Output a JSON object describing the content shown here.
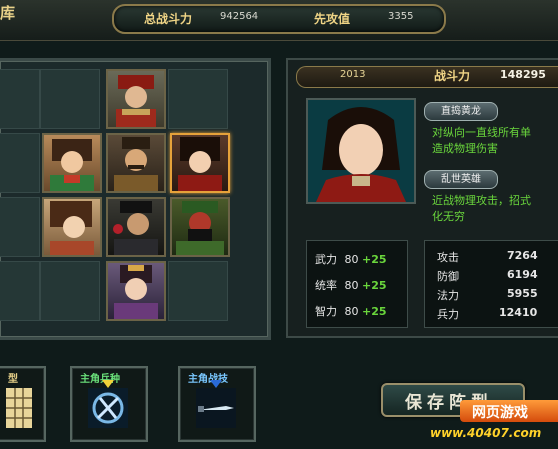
{
  "header": {
    "corner_title": "库",
    "total_power_label": "总战斗力",
    "total_power_value": "942564",
    "initiative_label": "先攻值",
    "initiative_value": "3355"
  },
  "formation": {
    "portraits": [
      {
        "name": "general-red-armor"
      },
      {
        "name": "general-female-green"
      },
      {
        "name": "general-mustache"
      },
      {
        "name": "general-female-red"
      },
      {
        "name": "general-female-brown"
      },
      {
        "name": "general-dark-armor"
      },
      {
        "name": "general-guan-yu"
      },
      {
        "name": "general-female-purple"
      }
    ]
  },
  "detail": {
    "year": "2013",
    "power_label": "战斗力",
    "power_value": "148295",
    "skill1_name": "直捣黄龙",
    "skill1_desc_line1": "对纵向一直线所有单",
    "skill1_desc_line2": "造成物理伤害",
    "skill2_name": "乱世英雄",
    "skill2_desc_line1": "近战物理攻击，招式",
    "skill2_desc_line2": "化无穷",
    "base_stats": [
      {
        "label": "武力",
        "value": "80",
        "bonus": "+25"
      },
      {
        "label": "统率",
        "value": "80",
        "bonus": "+25"
      },
      {
        "label": "智力",
        "value": "80",
        "bonus": "+25"
      }
    ],
    "combat_stats": [
      {
        "label": "攻击",
        "value": "7264"
      },
      {
        "label": "防御",
        "value": "6194"
      },
      {
        "label": "法力",
        "value": "5955"
      },
      {
        "label": "兵力",
        "value": "12410"
      }
    ]
  },
  "bottom": {
    "formation_label": "型",
    "troop_label": "主角兵种",
    "tactic_label": "主角战技",
    "save_label": "保存阵型"
  },
  "watermark": {
    "badge": "网页游戏",
    "url": "www.40407.com"
  },
  "colors": {
    "accent_gold": "#f0d586",
    "bonus_green": "#6ad63c",
    "selected_border": "#e6a23a"
  }
}
